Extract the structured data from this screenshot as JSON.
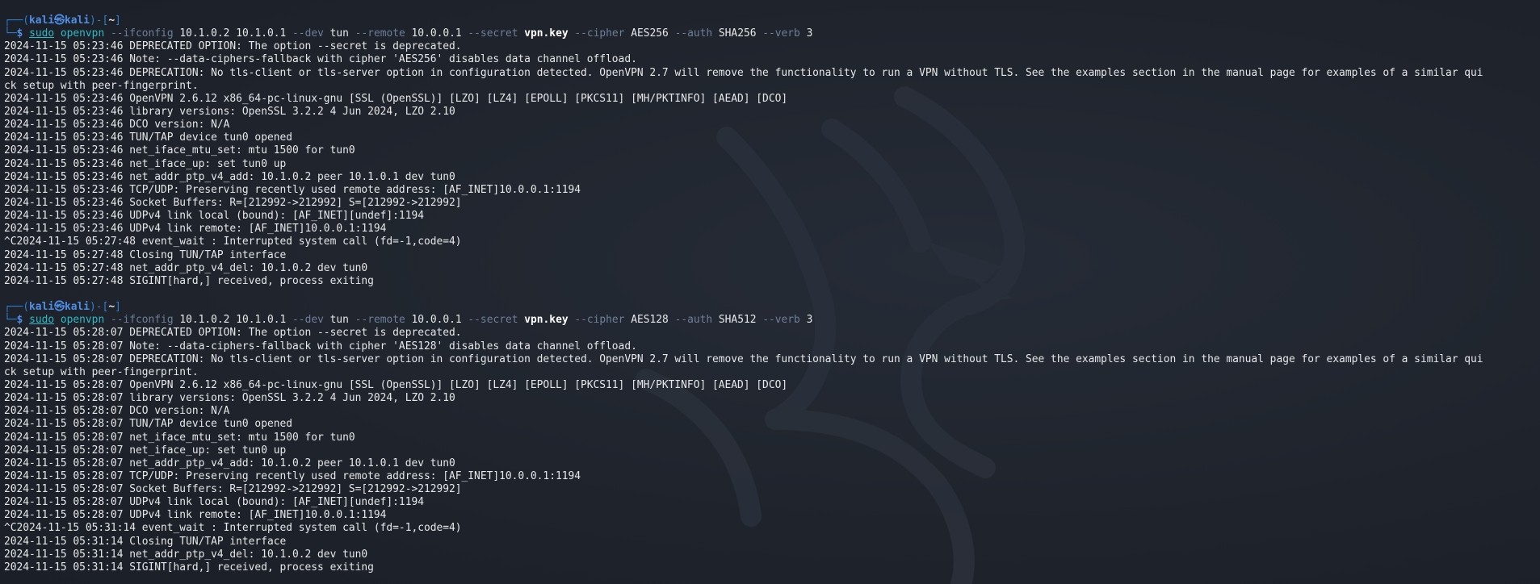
{
  "prompt": {
    "user": "kali",
    "at_symbol": "㉿",
    "host": "kali",
    "cwd": "~",
    "dollar": "$"
  },
  "sessions": [
    {
      "command": {
        "sudo": "sudo",
        "program": "openvpn",
        "tokens": [
          {
            "t": "opt",
            "v": "--ifconfig"
          },
          {
            "t": "arg",
            "v": "10.1.0.2 10.1.0.1"
          },
          {
            "t": "opt",
            "v": "--dev"
          },
          {
            "t": "arg",
            "v": "tun"
          },
          {
            "t": "opt",
            "v": "--remote"
          },
          {
            "t": "arg",
            "v": "10.0.0.1"
          },
          {
            "t": "opt",
            "v": "--secret"
          },
          {
            "t": "argb",
            "v": "vpn.key"
          },
          {
            "t": "opt",
            "v": "--cipher"
          },
          {
            "t": "arg",
            "v": "AES256"
          },
          {
            "t": "opt",
            "v": "--auth"
          },
          {
            "t": "arg",
            "v": "SHA256"
          },
          {
            "t": "opt",
            "v": "--verb"
          },
          {
            "t": "arg",
            "v": "3"
          }
        ]
      },
      "output": [
        "2024-11-15 05:23:46 DEPRECATED OPTION: The option --secret is deprecated.",
        "2024-11-15 05:23:46 Note: --data-ciphers-fallback with cipher 'AES256' disables data channel offload.",
        "2024-11-15 05:23:46 DEPRECATION: No tls-client or tls-server option in configuration detected. OpenVPN 2.7 will remove the functionality to run a VPN without TLS. See the examples section in the manual page for examples of a similar qui",
        "ck setup with peer-fingerprint.",
        "2024-11-15 05:23:46 OpenVPN 2.6.12 x86_64-pc-linux-gnu [SSL (OpenSSL)] [LZO] [LZ4] [EPOLL] [PKCS11] [MH/PKTINFO] [AEAD] [DCO]",
        "2024-11-15 05:23:46 library versions: OpenSSL 3.2.2 4 Jun 2024, LZO 2.10",
        "2024-11-15 05:23:46 DCO version: N/A",
        "2024-11-15 05:23:46 TUN/TAP device tun0 opened",
        "2024-11-15 05:23:46 net_iface_mtu_set: mtu 1500 for tun0",
        "2024-11-15 05:23:46 net_iface_up: set tun0 up",
        "2024-11-15 05:23:46 net_addr_ptp_v4_add: 10.1.0.2 peer 10.1.0.1 dev tun0",
        "2024-11-15 05:23:46 TCP/UDP: Preserving recently used remote address: [AF_INET]10.0.0.1:1194",
        "2024-11-15 05:23:46 Socket Buffers: R=[212992->212992] S=[212992->212992]",
        "2024-11-15 05:23:46 UDPv4 link local (bound): [AF_INET][undef]:1194",
        "2024-11-15 05:23:46 UDPv4 link remote: [AF_INET]10.0.0.1:1194",
        "^C2024-11-15 05:27:48 event_wait : Interrupted system call (fd=-1,code=4)",
        "2024-11-15 05:27:48 Closing TUN/TAP interface",
        "2024-11-15 05:27:48 net_addr_ptp_v4_del: 10.1.0.2 dev tun0",
        "2024-11-15 05:27:48 SIGINT[hard,] received, process exiting"
      ]
    },
    {
      "command": {
        "sudo": "sudo",
        "program": "openvpn",
        "tokens": [
          {
            "t": "opt",
            "v": "--ifconfig"
          },
          {
            "t": "arg",
            "v": "10.1.0.2 10.1.0.1"
          },
          {
            "t": "opt",
            "v": "--dev"
          },
          {
            "t": "arg",
            "v": "tun"
          },
          {
            "t": "opt",
            "v": "--remote"
          },
          {
            "t": "arg",
            "v": "10.0.0.1"
          },
          {
            "t": "opt",
            "v": "--secret"
          },
          {
            "t": "argb",
            "v": "vpn.key"
          },
          {
            "t": "opt",
            "v": "--cipher"
          },
          {
            "t": "arg",
            "v": "AES128"
          },
          {
            "t": "opt",
            "v": "--auth"
          },
          {
            "t": "arg",
            "v": "SHA512"
          },
          {
            "t": "opt",
            "v": "--verb"
          },
          {
            "t": "arg",
            "v": "3"
          }
        ]
      },
      "output": [
        "2024-11-15 05:28:07 DEPRECATED OPTION: The option --secret is deprecated.",
        "2024-11-15 05:28:07 Note: --data-ciphers-fallback with cipher 'AES128' disables data channel offload.",
        "2024-11-15 05:28:07 DEPRECATION: No tls-client or tls-server option in configuration detected. OpenVPN 2.7 will remove the functionality to run a VPN without TLS. See the examples section in the manual page for examples of a similar qui",
        "ck setup with peer-fingerprint.",
        "2024-11-15 05:28:07 OpenVPN 2.6.12 x86_64-pc-linux-gnu [SSL (OpenSSL)] [LZO] [LZ4] [EPOLL] [PKCS11] [MH/PKTINFO] [AEAD] [DCO]",
        "2024-11-15 05:28:07 library versions: OpenSSL 3.2.2 4 Jun 2024, LZO 2.10",
        "2024-11-15 05:28:07 DCO version: N/A",
        "2024-11-15 05:28:07 TUN/TAP device tun0 opened",
        "2024-11-15 05:28:07 net_iface_mtu_set: mtu 1500 for tun0",
        "2024-11-15 05:28:07 net_iface_up: set tun0 up",
        "2024-11-15 05:28:07 net_addr_ptp_v4_add: 10.1.0.2 peer 10.1.0.1 dev tun0",
        "2024-11-15 05:28:07 TCP/UDP: Preserving recently used remote address: [AF_INET]10.0.0.1:1194",
        "2024-11-15 05:28:07 Socket Buffers: R=[212992->212992] S=[212992->212992]",
        "2024-11-15 05:28:07 UDPv4 link local (bound): [AF_INET][undef]:1194",
        "2024-11-15 05:28:07 UDPv4 link remote: [AF_INET]10.0.0.1:1194",
        "^C2024-11-15 05:31:14 event_wait : Interrupted system call (fd=-1,code=4)",
        "2024-11-15 05:31:14 Closing TUN/TAP interface",
        "2024-11-15 05:31:14 net_addr_ptp_v4_del: 10.1.0.2 dev tun0",
        "2024-11-15 05:31:14 SIGINT[hard,] received, process exiting"
      ]
    }
  ]
}
